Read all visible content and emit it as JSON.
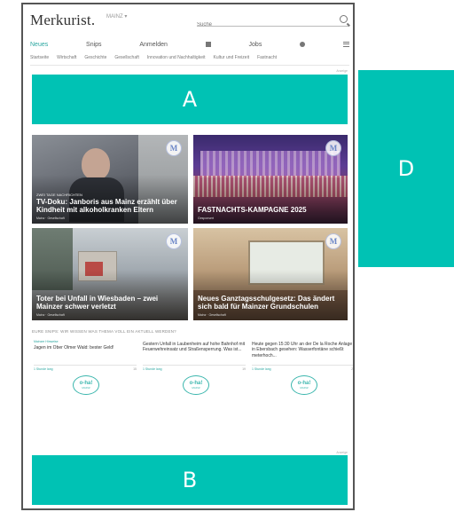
{
  "header": {
    "logo": "Merkurist.",
    "logo_sub": "MAINZ ▾",
    "search_placeholder": "Suche"
  },
  "main_nav": {
    "items": [
      {
        "label": "Neues",
        "active": true
      },
      {
        "label": "Snips"
      },
      {
        "label": "Anmelden"
      },
      {
        "label": "Jobs"
      }
    ]
  },
  "sub_nav": [
    "Startseite",
    "Wirtschaft",
    "Geschichte",
    "Gesellschaft",
    "Innovation und Nachhaltigkeit",
    "Kultur und Freizeit",
    "Fastnacht"
  ],
  "ads": {
    "a": "A",
    "b": "B",
    "d": "D",
    "label": "Anzeige"
  },
  "tiles": [
    {
      "kicker": "ZWEI TAGE NACHRICHTEN",
      "headline": "TV-Doku: Janboris aus Mainz erzählt über Kindheit mit alkoholkranken Eltern",
      "meta": "Mainz · Gesellschaft",
      "badge": "M"
    },
    {
      "kicker": "",
      "headline": "FASTNACHTS-KAMPAGNE 2025",
      "meta": "Gesponsert",
      "badge": "M"
    },
    {
      "kicker": "",
      "headline": "Toter bei Unfall in Wiesbaden – zwei Mainzer schwer verletzt",
      "meta": "Mainz · Gesellschaft",
      "badge": "M"
    },
    {
      "kicker": "",
      "headline": "Neues Ganztagsschulgesetz: Das ändert sich bald für Mainzer Grundschulen",
      "meta": "Mainz · Gesellschaft",
      "badge": "M"
    }
  ],
  "section_title": "EURE SNIPS: WIR WISSEN WAS THEMA VOLL EIN AKTUELL WERDEN?",
  "cards": [
    {
      "source": "Mainzer Hinweise",
      "text": "Jagen im Ober Olmer Wald: bester Geld!",
      "link": "1 Stunde lang",
      "count": "15"
    },
    {
      "source": "",
      "text": "Gestern Unfall in Laubenheim auf hohe Bahnhof mit Feuerwehreinsatz und Straßensperrung. Was ist...",
      "link": "1 Stunde lang",
      "count": "19"
    },
    {
      "source": "",
      "text": "Heute gegen 15:30 Uhr an der De la Roche Anlage in Ebersbach gesehen: Wasserfontäne schießt meterhoch...",
      "link": "1 Stunde lang",
      "count": "27"
    }
  ],
  "ohu": [
    {
      "label": "o-ha!",
      "sub": "MAINZ"
    },
    {
      "label": "o-ha!",
      "sub": "MAINZ"
    },
    {
      "label": "o-ha!",
      "sub": "MAINZ"
    }
  ],
  "colors": {
    "ad": "#00c2b4",
    "accent": "#2aa6a0"
  }
}
